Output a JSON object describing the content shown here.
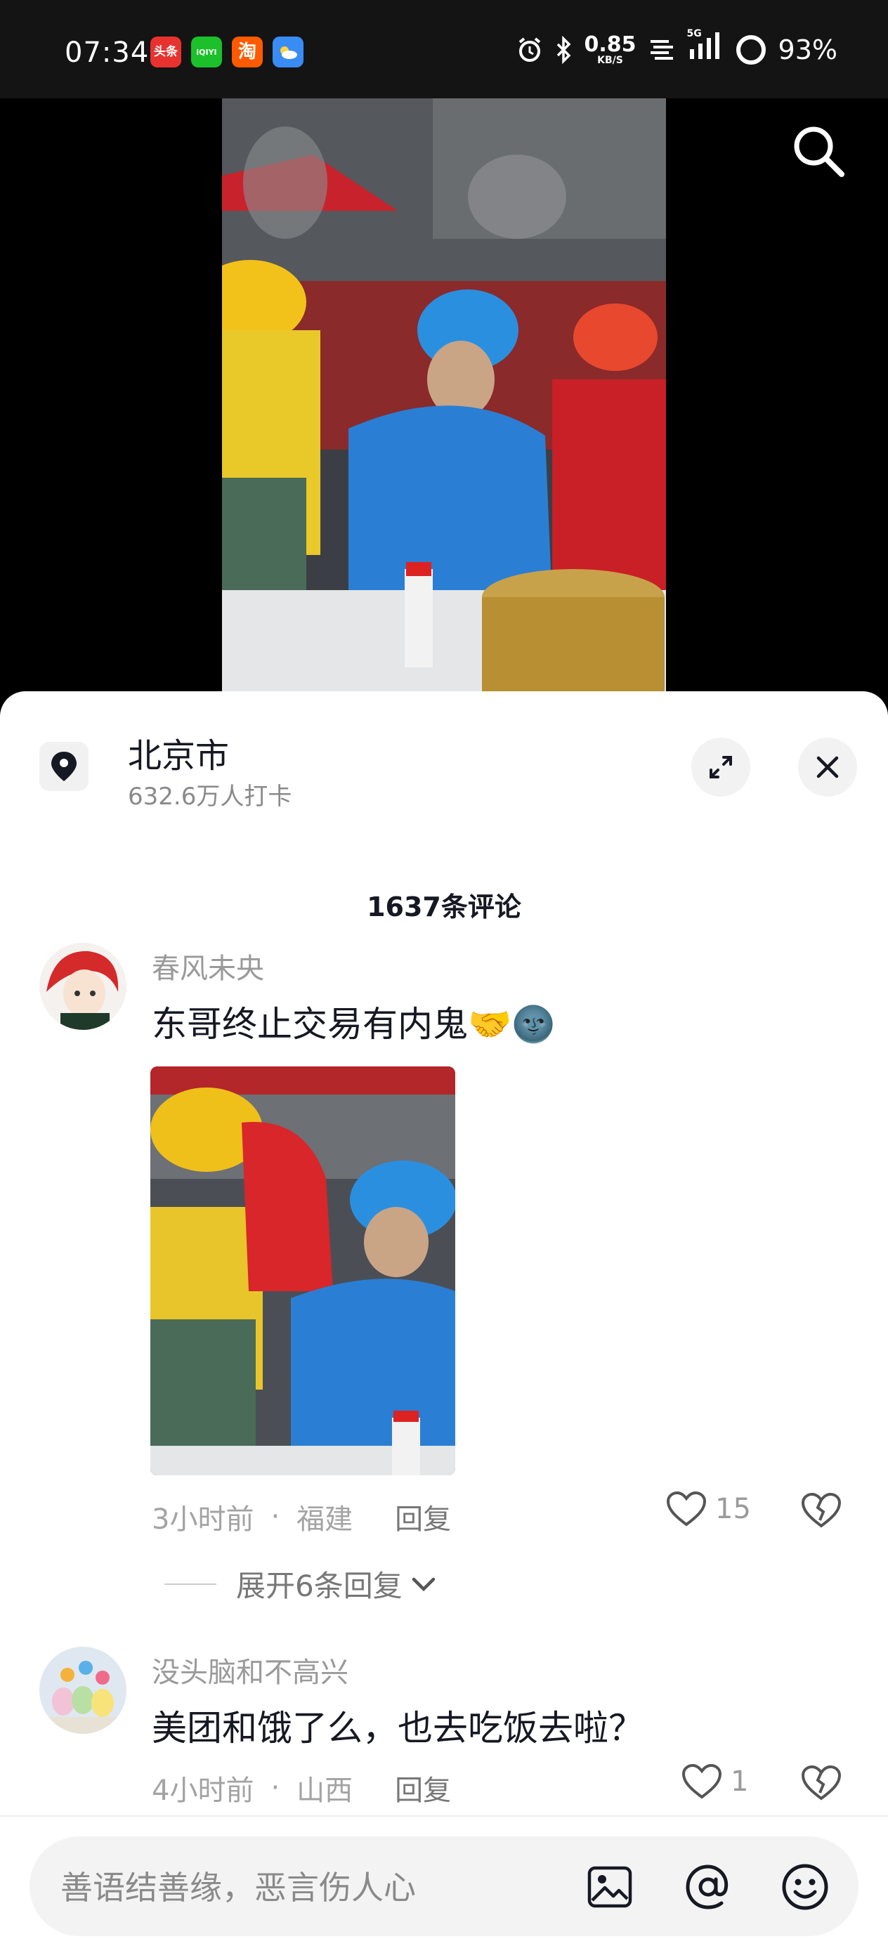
{
  "status_bar": {
    "time": "07:34",
    "apps": [
      {
        "label": "头条",
        "color": "#e8322f"
      },
      {
        "label": "iQIYI",
        "color": "#1cc02a"
      },
      {
        "label": "淘",
        "color": "#ff5a00"
      },
      {
        "label": "",
        "color": "#3a8cf5"
      }
    ],
    "speed_value": "0.85",
    "speed_unit": "KB/S",
    "network": "5G",
    "battery": "93%"
  },
  "location": {
    "name": "北京市",
    "checkins": "632.6万人打卡"
  },
  "comments_header": "1637条评论",
  "comments": [
    {
      "user": "春风未央",
      "text": "东哥终止交易有内鬼🤝🌚",
      "time": "3小时前",
      "region": "福建",
      "reply_label": "回复",
      "likes": "15",
      "has_image": true
    },
    {
      "user": "没头脑和不高兴",
      "text": "美团和饿了么，也去吃饭去啦？",
      "time": "4小时前",
      "region": "山西",
      "reply_label": "回复",
      "likes": "1",
      "has_image": false
    }
  ],
  "expand_replies": "展开6条回复",
  "input": {
    "placeholder": "善语结善缘，恶言伤人心"
  },
  "icons": {
    "search": "search-icon",
    "location": "location-pin-icon",
    "expand": "expand-icon",
    "close": "close-icon",
    "heart": "heart-icon",
    "broken_heart": "broken-heart-icon",
    "image": "image-icon",
    "at": "at-icon",
    "emoji": "emoji-icon"
  }
}
